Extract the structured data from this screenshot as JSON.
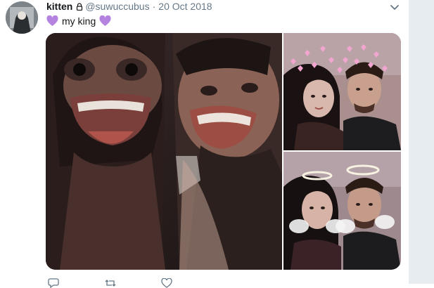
{
  "tweet": {
    "display_name": "kitten",
    "handle": "@suwuccubus",
    "separator": "·",
    "date": "20 Oct 2018",
    "text": "my king",
    "heart_color": "#b483e0"
  },
  "media": {
    "photo_count": 3
  },
  "icons": {
    "lock": "lock-icon",
    "caret": "chevron-down-icon",
    "reply": "reply-icon",
    "retweet": "retweet-icon",
    "like": "like-icon"
  }
}
